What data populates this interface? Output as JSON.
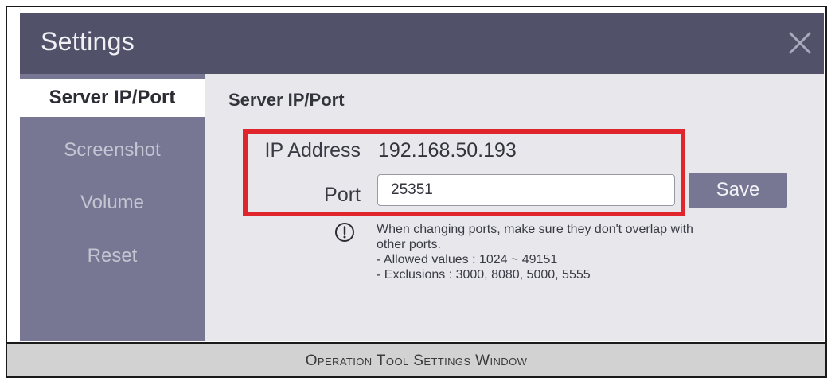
{
  "window": {
    "title": "Settings",
    "close_icon": "close-icon"
  },
  "sidebar": {
    "items": [
      {
        "label": "Server IP/Port",
        "active": true
      },
      {
        "label": "Screenshot",
        "active": false
      },
      {
        "label": "Volume",
        "active": false
      },
      {
        "label": "Reset",
        "active": false
      }
    ]
  },
  "content": {
    "section_title": "Server IP/Port",
    "ip_label": "IP Address",
    "ip_value": "192.168.50.193",
    "port_label": "Port",
    "port_value": "25351",
    "save_label": "Save",
    "info_icon": "exclamation-circle-icon",
    "info_lines": [
      "When changing ports, make sure they don't overlap with",
      "other ports.",
      "- Allowed values : 1024 ~ 49151",
      "- Exclusions : 3000, 8080, 5000, 5555"
    ]
  },
  "caption": {
    "text": "Operation Tool Settings Window"
  },
  "colors": {
    "titlebar": "#51526a",
    "sidebar": "#777793",
    "content_bg": "#e8e8ec",
    "highlight": "#e0262c",
    "save_button": "#777793",
    "caption_bg": "#d2d2d2"
  }
}
